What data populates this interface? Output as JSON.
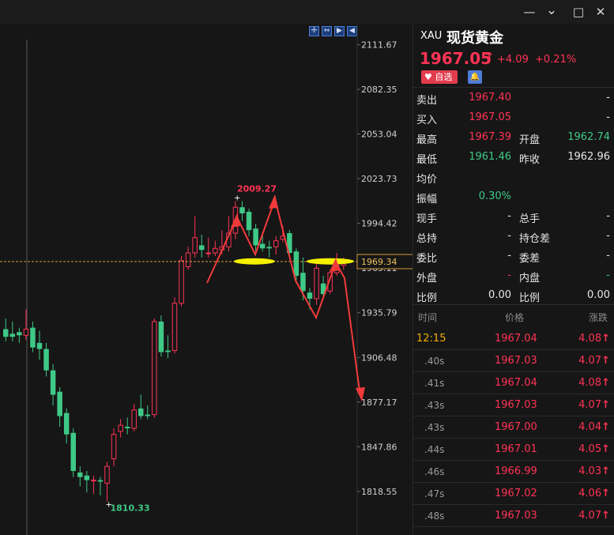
{
  "window": {
    "minimize_glyph": "—",
    "restore_glyph": "⌄",
    "maximize_glyph": "□",
    "close_glyph": "✕"
  },
  "toolbar": {
    "icons": [
      {
        "name": "crosshair-tool-icon",
        "glyph": "✢"
      },
      {
        "name": "fit-range-tool-icon",
        "glyph": "⇔"
      },
      {
        "name": "step-forward-tool-icon",
        "glyph": "▶"
      },
      {
        "name": "step-back-tool-icon",
        "glyph": "◀"
      }
    ]
  },
  "chart_data": {
    "type": "candlestick",
    "price_axis_ticks": [
      "2111.67",
      "2082.35",
      "2053.04",
      "2023.73",
      "1994.42",
      "1965.11",
      "1935.79",
      "1906.48",
      "1877.17",
      "1847.86",
      "1818.55"
    ],
    "ylim": [
      1804,
      2115
    ],
    "current_price_tag": "1969.34",
    "high_label": "2009.27",
    "low_label": "1810.33",
    "colors": {
      "up": "#ff3355",
      "down": "#3ec986",
      "annotation": "#f23a3a",
      "highlight": "#f5f000",
      "price_line": "#d99a3c"
    },
    "candles": [
      [
        1925,
        1920,
        1932,
        1917
      ],
      [
        1922,
        1920,
        1930,
        1917
      ],
      [
        1923,
        1921,
        1926,
        1916
      ],
      [
        1921,
        1925,
        1938,
        1918
      ],
      [
        1926,
        1913,
        1930,
        1910
      ],
      [
        1916,
        1912,
        1924,
        1905
      ],
      [
        1912,
        1898,
        1916,
        1894
      ],
      [
        1898,
        1882,
        1902,
        1875
      ],
      [
        1884,
        1868,
        1887,
        1861
      ],
      [
        1870,
        1856,
        1873,
        1850
      ],
      [
        1857,
        1832,
        1860,
        1828
      ],
      [
        1831,
        1828,
        1835,
        1822
      ],
      [
        1829,
        1826,
        1832,
        1818
      ],
      [
        1826,
        1826,
        1829,
        1817
      ],
      [
        1826,
        1825,
        1828,
        1816
      ],
      [
        1824,
        1835,
        1838,
        1812
      ],
      [
        1840,
        1856,
        1860,
        1835
      ],
      [
        1858,
        1862,
        1866,
        1854
      ],
      [
        1861,
        1860,
        1867,
        1856
      ],
      [
        1860,
        1872,
        1876,
        1858
      ],
      [
        1873,
        1868,
        1882,
        1866
      ],
      [
        1869,
        1868,
        1875,
        1866
      ],
      [
        1869,
        1930,
        1932,
        1867
      ],
      [
        1930,
        1910,
        1934,
        1907
      ],
      [
        1911,
        1910,
        1921,
        1906
      ],
      [
        1911,
        1942,
        1946,
        1909
      ],
      [
        1942,
        1970,
        1973,
        1940
      ],
      [
        1966,
        1975,
        1979,
        1964
      ],
      [
        1975,
        1985,
        1999,
        1972
      ],
      [
        1980,
        1977,
        1987,
        1972
      ],
      [
        1975,
        1975,
        1985,
        1972
      ],
      [
        1975,
        1978,
        1983,
        1973
      ],
      [
        1977,
        1979,
        1990,
        1974
      ],
      [
        1979,
        1988,
        1999,
        1976
      ],
      [
        1988,
        2005,
        2009,
        1984
      ],
      [
        2005,
        2001,
        2009,
        1996
      ],
      [
        2002,
        1990,
        2004,
        1986
      ],
      [
        1991,
        1980,
        1994,
        1975
      ],
      [
        1981,
        1978,
        1987,
        1976
      ],
      [
        1979,
        1978,
        1983,
        1972
      ],
      [
        1979,
        1983,
        1986,
        1974
      ],
      [
        1984,
        1986,
        1993,
        1982
      ],
      [
        1988,
        1975,
        1990,
        1973
      ],
      [
        1976,
        1960,
        1978,
        1955
      ],
      [
        1962,
        1950,
        1972,
        1944
      ],
      [
        1949,
        1945,
        1952,
        1938
      ],
      [
        1945,
        1965,
        1968,
        1941
      ],
      [
        1955,
        1948,
        1960,
        1946
      ],
      [
        1950,
        1962,
        1964,
        1948
      ],
      [
        1962,
        1967,
        1975,
        1960
      ],
      [
        1967,
        1968,
        1972,
        1964
      ]
    ]
  },
  "quote": {
    "symbol": "XAU",
    "name": "现货黄金",
    "price": "1967.05",
    "arrow": "↑",
    "change": "+4.09",
    "change_pct": "+0.21%",
    "watch_label": "自选",
    "heart_glyph": "♥",
    "bell_glyph": "🔔",
    "rows": [
      {
        "l1": "卖出",
        "v1": "1967.40",
        "c1": "red",
        "l2": "",
        "v2": "-",
        "c2": ""
      },
      {
        "l1": "买入",
        "v1": "1967.05",
        "c1": "red",
        "l2": "",
        "v2": "-",
        "c2": ""
      },
      {
        "l1": "最高",
        "v1": "1967.39",
        "c1": "red",
        "l2": "开盘",
        "v2": "1962.74",
        "c2": "green"
      },
      {
        "l1": "最低",
        "v1": "1961.46",
        "c1": "green",
        "l2": "昨收",
        "v2": "1962.96",
        "c2": ""
      },
      {
        "l1": "均价",
        "v1": "",
        "c1": "",
        "l2": "",
        "v2": "",
        "c2": ""
      },
      {
        "l1": "振幅",
        "v1": "0.30%",
        "c1": "green",
        "l2": "",
        "v2": "",
        "c2": ""
      },
      {
        "l1": "现手",
        "v1": "-",
        "c1": "",
        "l2": "总手",
        "v2": "-",
        "c2": ""
      },
      {
        "l1": "总持",
        "v1": "-",
        "c1": "",
        "l2": "持仓差",
        "v2": "-",
        "c2": ""
      },
      {
        "l1": "委比",
        "v1": "-",
        "c1": "",
        "l2": "委差",
        "v2": "-",
        "c2": ""
      },
      {
        "l1": "外盘",
        "v1": "-",
        "c1": "red",
        "l2": "内盘",
        "v2": "-",
        "c2": "green"
      },
      {
        "l1": "比例",
        "v1": "0.00",
        "c1": "",
        "l2": "比例",
        "v2": "0.00",
        "c2": ""
      }
    ]
  },
  "ticks": {
    "headers": {
      "time": "时间",
      "price": "价格",
      "change": "涨跌"
    },
    "rows": [
      {
        "time": "12:15",
        "price": "1967.04",
        "change": "4.08",
        "highlight": true
      },
      {
        "time": ".40s",
        "price": "1967.03",
        "change": "4.07"
      },
      {
        "time": ".41s",
        "price": "1967.04",
        "change": "4.08"
      },
      {
        "time": ".43s",
        "price": "1967.03",
        "change": "4.07"
      },
      {
        "time": ".43s",
        "price": "1967.00",
        "change": "4.04"
      },
      {
        "time": ".44s",
        "price": "1967.01",
        "change": "4.05"
      },
      {
        "time": ".46s",
        "price": "1966.99",
        "change": "4.03"
      },
      {
        "time": ".47s",
        "price": "1967.02",
        "change": "4.06"
      },
      {
        "time": ".48s",
        "price": "1967.03",
        "change": "4.07"
      }
    ],
    "up_arrow": "↑"
  }
}
